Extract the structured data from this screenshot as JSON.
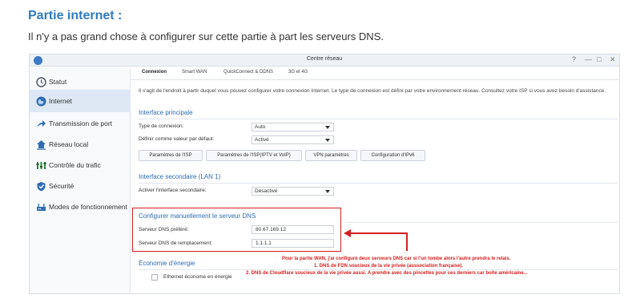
{
  "page": {
    "heading": "Partie internet :",
    "intro": "Il n'y a pas grand chose à configurer sur cette partie à part les serveurs DNS."
  },
  "window": {
    "title": "Centre réseau",
    "controls": [
      "?",
      "—",
      "□",
      "✕"
    ]
  },
  "sidebar": {
    "items": [
      {
        "label": "Statut",
        "icon": "clock-icon",
        "active": false
      },
      {
        "label": "Internet",
        "icon": "globe-icon",
        "active": true
      },
      {
        "label": "Transmission de port",
        "icon": "arrow-icon",
        "active": false
      },
      {
        "label": "Réseau local",
        "icon": "home-icon",
        "active": false
      },
      {
        "label": "Contrôle du trafic",
        "icon": "traffic-icon",
        "active": false
      },
      {
        "label": "Sécurité",
        "icon": "shield-icon",
        "active": false
      },
      {
        "label": "Modes de fonctionnement",
        "icon": "modes-icon",
        "active": false
      }
    ]
  },
  "tabs": [
    "Connexion",
    "Smart WAN",
    "QuickConnect & DDNS",
    "3G et 4G"
  ],
  "connexion": {
    "description": "Il s'agit de l'endroit à partir duquel vous pouvez configurer votre connexion Internet. Le type de connexion est défini par votre environnement réseau. Consultez votre ISP si vous avez besoin d'assistance.",
    "interface_principale": {
      "title": "Interface principale",
      "type_label": "Type de connexion:",
      "type_value": "Auto",
      "default_label": "Définir comme valeur par défaut:",
      "default_value": "Activé",
      "buttons": [
        "Paramètres de l'ISP",
        "Paramètres de l'ISP(IPTV et VoIP)",
        "VPN paramètres",
        "Configuration d'IPv6"
      ]
    },
    "interface_secondaire": {
      "title": "Interface secondaire (LAN 1)",
      "enable_label": "Activer l'interface secondaire:",
      "enable_value": "Désactivé"
    },
    "dns": {
      "title": "Configurer manuellement le serveur DNS",
      "preferred_label": "Serveur DNS préféré:",
      "preferred_value": "80.67.169.12",
      "alternate_label": "Serveur DNS de remplacement:",
      "alternate_value": "1.1.1.1"
    },
    "energie": {
      "title": "Économie d'énergie",
      "checkbox_label": "Ethernet économe en énergie"
    }
  },
  "annotation": {
    "line1": "Pour la partie WAN, j'ai configuré deux serveurs DNS car si l'un tombe alors l'autre prendra le relais.",
    "line2": "1. DNS de FDN soucieux de la vie privée (asssociation française).",
    "line3": "2. DNS de Cloudflare soucieux de la vie privée aussi. A prendre avec des pincettes pour ces derniers car boite américaine...",
    "color": "#d32020"
  }
}
